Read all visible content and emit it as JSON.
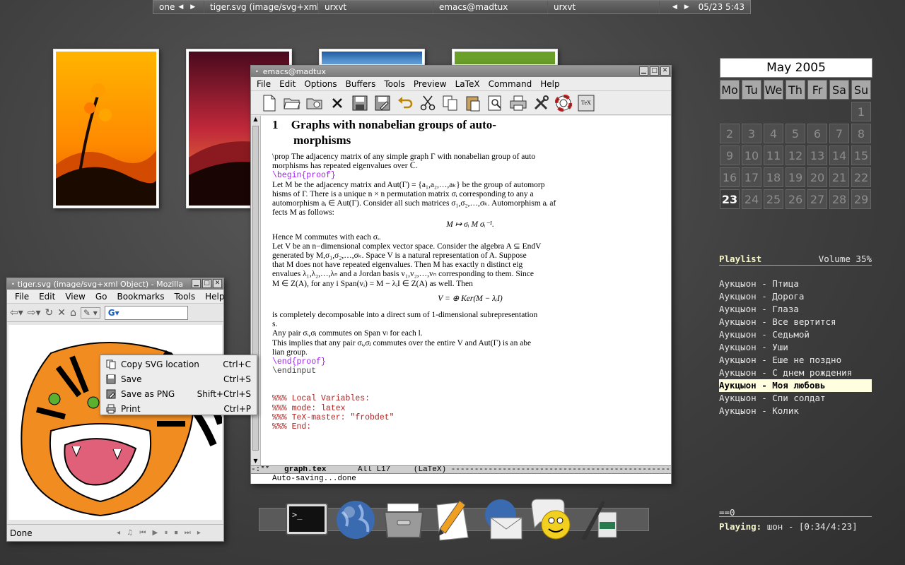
{
  "toppanel": {
    "workspace": "one",
    "tasks": [
      "tiger.svg (image/svg+xml",
      "urxvt",
      "emacs@madtux",
      "urxvt"
    ],
    "clock": "05/23 5:43"
  },
  "emacs": {
    "title": "emacs@madtux",
    "menu": [
      "File",
      "Edit",
      "Options",
      "Buffers",
      "Tools",
      "Preview",
      "LaTeX",
      "Command",
      "Help"
    ],
    "toolbar_icons": [
      "new-file-icon",
      "open-folder-icon",
      "open-dir-icon",
      "close-icon",
      "save-icon",
      "save-as-icon",
      "undo-icon",
      "cut-icon",
      "copy-icon",
      "paste-icon",
      "search-icon",
      "print-icon",
      "tools-icon",
      "help-icon",
      "tex-icon"
    ],
    "section_number": "1",
    "section_title_1": "Graphs with nonabelian groups of auto-",
    "section_title_2": "morphisms",
    "lines": [
      "\\prop The adjacency matrix of any simple graph Γ with nonabelian group of auto",
      "morphisms has repeated eigenvalues over ℂ.",
      "\\begin{proof}",
      "Let M be the adjacency matrix and Aut(Γ) = {a₁,a₂,…,aₖ} be the group of automorp",
      "hisms of Γ. There is a unique n × n permutation matrix σᵢ corresponding to any a",
      "automorphism aᵢ ∈ Aut(Γ). Consider all such matrices σ₁,σ₂,…,σₖ. Automorphism aᵢ af",
      "fects M as follows:"
    ],
    "math1": "M ↦ σᵢ M σᵢ⁻¹.",
    "lines2": [
      "Hence M commutes with each σᵢ.",
      "Let V be an n−dimensional complex vector space. Consider the algebra A ⊆ EndV",
      " generated by M,σ₁,σ₂,…,σₖ. Space V is a natural representation of A. Suppose",
      "that M does not have repeated eigenvalues. Then M has exactly n distinct eig",
      "envalues λ₁,λ₂,…,λₙ and a Jordan basis v₁,v₂,…,vₙ corresponding to them. Since",
      "M ∈ Z(A), for any i  Span(vᵢ) = M − λᵢI ∈ Z(A) as well. Then"
    ],
    "math2": "V = ⊕ Ker(M − λᵢI)",
    "lines3": [
      "is completely decomposable into a direct sum of 1-dimensional subrepresentation",
      "s.",
      "Any pair σᵢ,σⱼ commutes on Span vₗ for each l.",
      "This implies that any pair σᵢ,σⱼ commutes over the entire V and Aut(Γ) is an abe",
      "lian group."
    ],
    "end_proof": "\\end{proof}",
    "endinput": "\\endinput",
    "local_vars": [
      "%%% Local Variables:",
      "%%% mode: latex",
      "%%% TeX-master: \"frobdet\"",
      "%%% End:"
    ],
    "modeline_prefix": "-:**",
    "modeline_buffer": "graph.tex",
    "modeline_pos": "All L17",
    "modeline_mode": "(LaTeX)",
    "minibuffer": "Auto-saving...done"
  },
  "mozilla": {
    "title": "tiger.svg (image/svg+xml Object) - Mozilla",
    "menu": [
      "File",
      "Edit",
      "View",
      "Go",
      "Bookmarks",
      "Tools",
      "Help"
    ],
    "status": "Done"
  },
  "context_menu": [
    {
      "label": "Copy SVG location",
      "shortcut": "Ctrl+C"
    },
    {
      "label": "Save",
      "shortcut": "Ctrl+S"
    },
    {
      "label": "Save as PNG",
      "shortcut": "Shift+Ctrl+S"
    },
    {
      "label": "Print",
      "shortcut": "Ctrl+P"
    }
  ],
  "calendar": {
    "month": "May 2005",
    "days": [
      "Mo",
      "Tu",
      "We",
      "Th",
      "Fr",
      "Sa",
      "Su"
    ],
    "weeks": [
      [
        "",
        "",
        "",
        "",
        "",
        "",
        "1"
      ],
      [
        "2",
        "3",
        "4",
        "5",
        "6",
        "7",
        "8"
      ],
      [
        "9",
        "10",
        "11",
        "12",
        "13",
        "14",
        "15"
      ],
      [
        "16",
        "17",
        "18",
        "19",
        "20",
        "21",
        "22"
      ],
      [
        "23",
        "24",
        "25",
        "26",
        "27",
        "28",
        "29"
      ]
    ],
    "today": "23"
  },
  "playlist": {
    "title": "Playlist",
    "volume": "Volume 35%",
    "tracks": [
      "Аукцыон - Птица",
      "Аукцыон - Дорога",
      "Аукцыон - Глаза",
      "Аукцыон - Все вертится",
      "Аукцыон - Седьмой",
      "Аукцыон - Уши",
      "Аукцыон - Еше не поздно",
      "Аукцыон - С днем рождения",
      "Аукцыон - Моя любовь",
      "Аукцыон - Спи солдат",
      "Аукцыон - Колик"
    ],
    "active_index": 8
  },
  "player": {
    "progress_text": "==0",
    "playing_label": "Playing:",
    "playing_text": "шон -   [0:34/4:23]",
    "progress_fraction": 0.13
  },
  "dock": {
    "items": [
      "terminal-icon",
      "browser-globe-icon",
      "file-manager-icon",
      "text-editor-icon",
      "mail-icon",
      "chat-icon",
      "paint-icon"
    ]
  },
  "colors": {
    "desktop": "#3f3f3f",
    "playlist_active_bg": "#ffffe0",
    "latex_keyword": "#a020f0",
    "latex_comment": "#b22222"
  }
}
